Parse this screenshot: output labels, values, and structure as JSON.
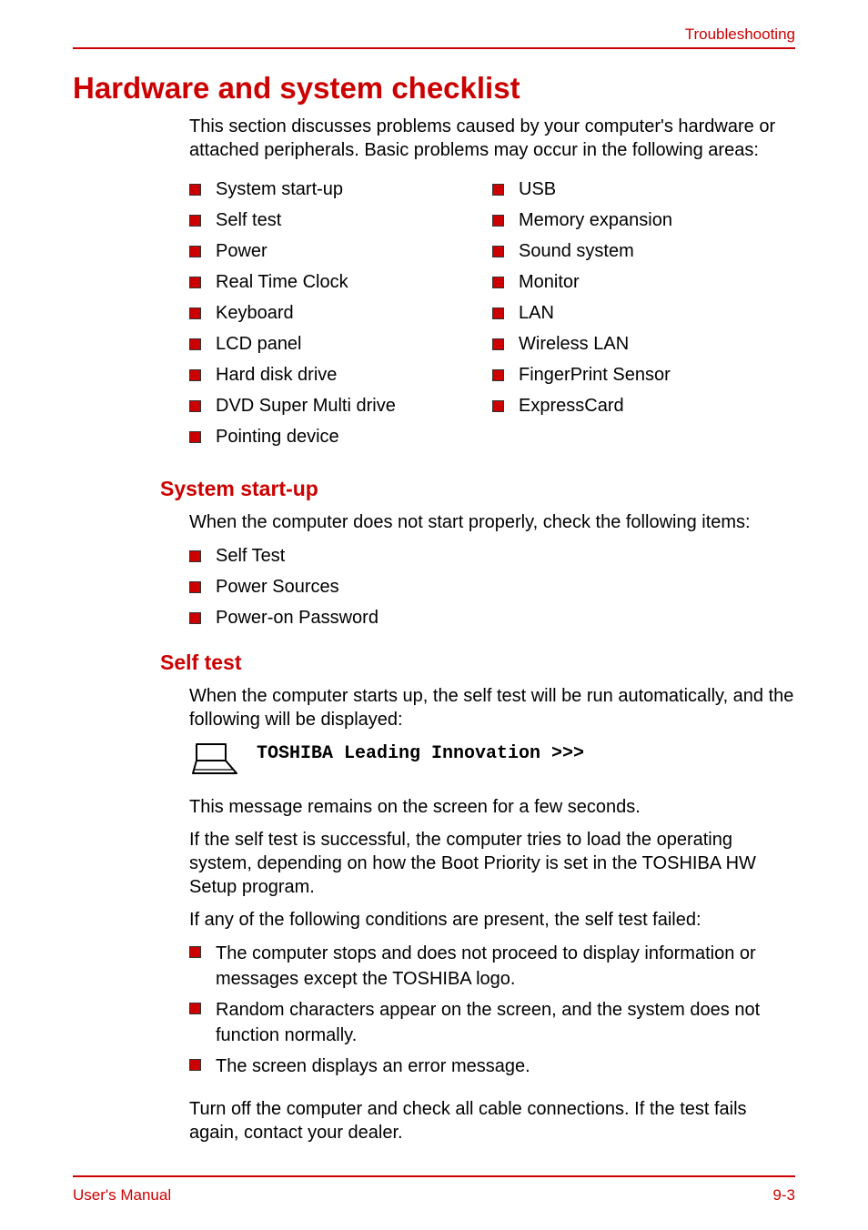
{
  "header": {
    "section": "Troubleshooting"
  },
  "title": "Hardware and system checklist",
  "intro": "This section discusses problems caused by your computer's hardware or attached peripherals. Basic problems may occur in the following areas:",
  "checklist_left": [
    "System start-up",
    "Self test",
    "Power",
    "Real Time Clock",
    "Keyboard",
    "LCD panel",
    "Hard disk drive",
    "DVD Super Multi drive",
    "Pointing device"
  ],
  "checklist_right": [
    "USB",
    "Memory expansion",
    "Sound system",
    "Monitor",
    "LAN",
    "Wireless LAN",
    "FingerPrint Sensor",
    "ExpressCard"
  ],
  "startup": {
    "heading": "System start-up",
    "text": "When the computer does not start properly, check the following items:",
    "items": [
      "Self Test",
      "Power Sources",
      "Power-on Password"
    ]
  },
  "selftest": {
    "heading": "Self test",
    "p1": "When the computer starts up, the self test will be run automatically, and the following will be displayed:",
    "mono": "TOSHIBA Leading Innovation >>>",
    "p2": "This message remains on the screen for a few seconds.",
    "p3": "If the self test is successful, the computer tries to load the operating system, depending on how the Boot Priority is set in the TOSHIBA HW Setup program.",
    "p4": "If any of the following conditions are present, the self test failed:",
    "fail_items": [
      "The computer stops and does not proceed to display information or messages except the TOSHIBA logo.",
      "Random characters appear on the screen, and the system does not function normally.",
      "The screen displays an error message."
    ],
    "p5": "Turn off the computer and check all cable connections. If the test fails again, contact your dealer."
  },
  "footer": {
    "left": "User's Manual",
    "right": "9-3"
  }
}
